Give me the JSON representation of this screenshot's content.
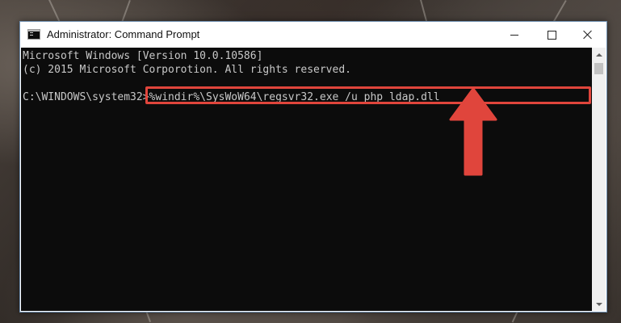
{
  "window": {
    "title": "Administrator: Command Prompt"
  },
  "console": {
    "lines": {
      "l1": "Microsoft Windows [Version 10.0.10586]",
      "l2": "(c) 2015 Microsoft Corporotion. All rights reserved.",
      "prompt": "C:\\WINDOWS\\system32>",
      "command": "%windir%\\SysWoW64\\regsvr32.exe /u php_ldap.dll"
    }
  },
  "icons": {
    "app": "command-prompt-icon",
    "minimize": "minimize-icon",
    "maximize": "maximize-icon",
    "close": "close-icon",
    "scroll_up": "chevron-up-icon",
    "scroll_down": "chevron-down-icon",
    "pointer": "arrow-up-icon"
  },
  "colors": {
    "console_bg": "#0c0c0c",
    "console_text": "#c8c8c8",
    "highlight": "#e0453c"
  }
}
